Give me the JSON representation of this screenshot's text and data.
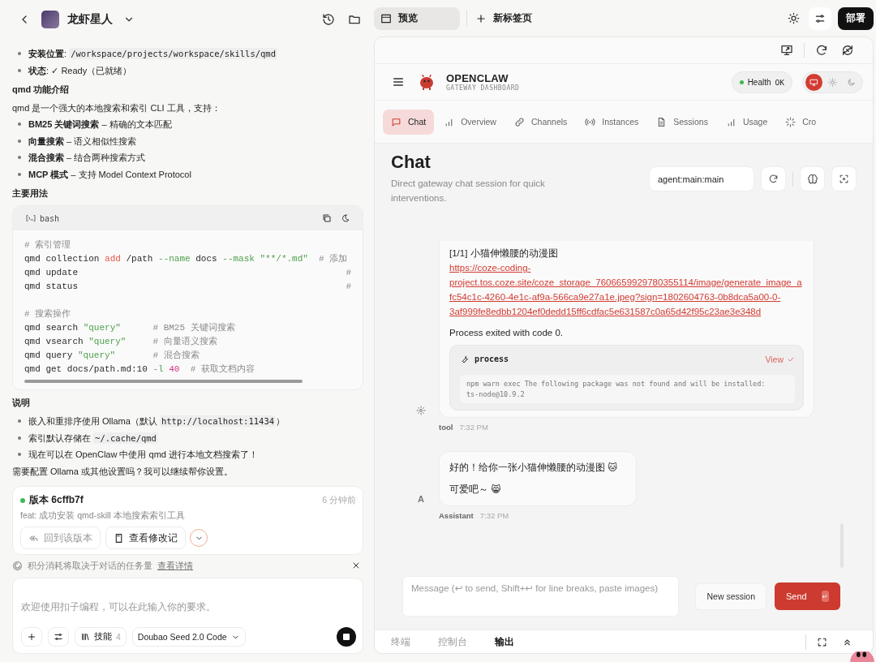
{
  "left_panel": {
    "header": {
      "title": "龙虾星人"
    },
    "content": [
      {
        "kind": "bullets",
        "items": [
          [
            {
              "kind": "bold",
              "text": "安装位置"
            },
            {
              "kind": "text",
              "text": ": "
            },
            {
              "kind": "code",
              "text": "/workspace/projects/workspace/skills/qmd"
            }
          ],
          [
            {
              "kind": "bold",
              "text": "状态"
            },
            {
              "kind": "text",
              "text": ": ✓ Ready（已就绪）"
            }
          ]
        ]
      },
      {
        "kind": "heading",
        "text": "qmd 功能介绍"
      },
      {
        "kind": "paragraph",
        "text": "qmd 是一个强大的本地搜索和索引 CLI 工具，支持："
      },
      {
        "kind": "bullets",
        "items": [
          [
            {
              "kind": "bold",
              "text": "BM25 关键词搜索"
            },
            {
              "kind": "text",
              "text": " – 精确的文本匹配"
            }
          ],
          [
            {
              "kind": "bold",
              "text": "向量搜索"
            },
            {
              "kind": "text",
              "text": " – 语义相似性搜索"
            }
          ],
          [
            {
              "kind": "bold",
              "text": "混合搜索"
            },
            {
              "kind": "text",
              "text": " – 结合两种搜索方式"
            }
          ],
          [
            {
              "kind": "bold",
              "text": "MCP 模式"
            },
            {
              "kind": "text",
              "text": " – 支持 Model Context Protocol"
            }
          ]
        ]
      },
      {
        "kind": "heading",
        "text": "主要用法"
      },
      {
        "kind": "code",
        "lang": "bash",
        "groups": [
          [
            [
              {
                "kind": "comment",
                "text": "# 索引管理"
              }
            ],
            [
              {
                "kind": "plain",
                "text": "qmd collection "
              },
              {
                "kind": "keyword",
                "text": "add"
              },
              {
                "kind": "plain",
                "text": " /path "
              },
              {
                "kind": "flag",
                "text": "--name"
              },
              {
                "kind": "plain",
                "text": " docs "
              },
              {
                "kind": "flag",
                "text": "--mask"
              },
              {
                "kind": "string",
                "text": " \"**/*.md\""
              },
              {
                "kind": "comment",
                "text": "  # 添加"
              }
            ],
            [
              {
                "kind": "plain",
                "text": "qmd update"
              },
              {
                "kind": "comment",
                "text": "#",
                "right_aligned": true
              }
            ],
            [
              {
                "kind": "plain",
                "text": "qmd status"
              },
              {
                "kind": "comment",
                "text": "#",
                "right_aligned": true
              }
            ]
          ],
          [
            [
              {
                "kind": "comment",
                "text": "# 搜索操作"
              }
            ],
            [
              {
                "kind": "plain",
                "text": "qmd search "
              },
              {
                "kind": "string",
                "text": "\"query\""
              },
              {
                "kind": "comment",
                "text": "      # BM25 关键词搜索"
              }
            ],
            [
              {
                "kind": "plain",
                "text": "qmd vsearch "
              },
              {
                "kind": "string",
                "text": "\"query\""
              },
              {
                "kind": "comment",
                "text": "     # 向量语义搜索"
              }
            ],
            [
              {
                "kind": "plain",
                "text": "qmd query "
              },
              {
                "kind": "string",
                "text": "\"query\""
              },
              {
                "kind": "comment",
                "text": "       # 混合搜索"
              }
            ],
            [
              {
                "kind": "plain",
                "text": "qmd get docs/path.md:10 "
              },
              {
                "kind": "flag",
                "text": "-l"
              },
              {
                "kind": "number",
                "text": " 40"
              },
              {
                "kind": "comment",
                "text": "  # 获取文档内容"
              }
            ]
          ]
        ]
      },
      {
        "kind": "heading",
        "text": "说明"
      },
      {
        "kind": "bullets",
        "items": [
          [
            {
              "kind": "text",
              "text": "嵌入和重排序使用 Ollama（默认 "
            },
            {
              "kind": "code",
              "text": "http://localhost:11434"
            },
            {
              "kind": "text",
              "text": "）"
            }
          ],
          [
            {
              "kind": "text",
              "text": "索引默认存储在 "
            },
            {
              "kind": "code",
              "text": "~/.cache/qmd"
            }
          ],
          [
            {
              "kind": "text",
              "text": "现在可以在 OpenClaw 中使用 qmd 进行本地文档搜索了！"
            }
          ]
        ]
      },
      {
        "kind": "paragraph",
        "text": "需要配置 Ollama 或其他设置吗？我可以继续帮你设置。"
      }
    ],
    "version_card": {
      "color": "#3fb950",
      "title": "版本 6cffb7f",
      "time": "6 分钟前",
      "message": "feat: 成功安装 qmd-skill 本地搜索索引工具",
      "revert": "回到该版本",
      "changes": "查看修改记"
    },
    "notice": {
      "text": "积分消耗将取决于对话的任务量",
      "link": "查看详情"
    },
    "composer": {
      "placeholder": "欢迎使用扣子编程，可以在此输入你的要求。",
      "skills": "技能",
      "skills_count": "4",
      "model": "Doubao Seed 2.0 Code"
    }
  },
  "right_panel": {
    "tabs": [
      {
        "label": "预览",
        "selected": true
      }
    ],
    "new_tab": "新标签页",
    "deploy": "部署",
    "app": {
      "brand": "OPENCLAW",
      "subtitle": "GATEWAY DASHBOARD",
      "health": {
        "label": "Health",
        "value": "OK",
        "color": "#3fb950"
      },
      "theme_modes": [
        {
          "selected": true
        },
        {
          "selected": false
        },
        {
          "selected": false
        }
      ],
      "nav": [
        {
          "label": "Chat",
          "selected": true
        },
        {
          "label": "Overview",
          "selected": false
        },
        {
          "label": "Channels",
          "selected": false
        },
        {
          "label": "Instances",
          "selected": false
        },
        {
          "label": "Sessions",
          "selected": false
        },
        {
          "label": "Usage",
          "selected": false
        },
        {
          "label": "Cro",
          "selected": false
        }
      ],
      "page": {
        "title": "Chat",
        "subtitle": "Direct gateway chat session for quick interventions.",
        "session": "agent:main:main"
      },
      "messages": [
        {
          "kind": "tool",
          "caption": "[1/1] 小猫伸懒腰的动漫图",
          "link": "https://coze-coding-project.tos.coze.site/coze_storage_7606659929780355114/image/generate_image_afc54c1c-4260-4e1c-af9a-566ca9e27a1e.jpeg?sign=1802604763-0b8dca5a00-0-3af999fe8edbb1204ef0dedd15ff6cdfac5e631587c0a65d42f95c23ae3e348d",
          "status": "Process exited with code 0.",
          "tool_card": {
            "name": "process",
            "action": "View",
            "output": "npm warn exec The following package was not found and will be installed:\nts-node@10.9.2"
          },
          "sender": "tool",
          "time": "7:32 PM"
        },
        {
          "kind": "assistant",
          "avatar": "A",
          "paragraphs": [
            "好的！给你一张小猫伸懒腰的动漫图 🐱",
            "可爱吧～ 😸"
          ],
          "sender": "Assistant",
          "time": "7:32 PM"
        }
      ],
      "composer": {
        "placeholder": "Message (↩ to send, Shift+↩ for line breaks, paste images)",
        "new_session": "New session",
        "send": "Send",
        "send_key": "↵"
      }
    },
    "bottom_tabs": [
      {
        "label": "终端",
        "selected": false
      },
      {
        "label": "控制台",
        "selected": false
      },
      {
        "label": "输出",
        "selected": true
      }
    ]
  }
}
